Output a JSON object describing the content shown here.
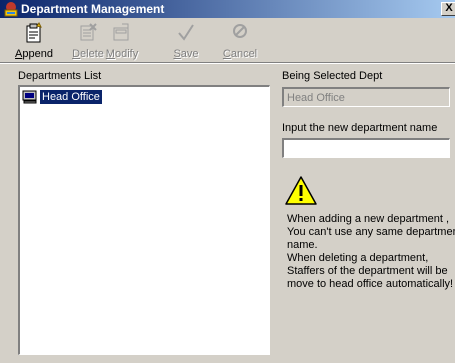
{
  "window": {
    "title": "Department Management",
    "close_label": "X"
  },
  "toolbar": {
    "buttons": [
      {
        "label": "Append",
        "accel": "A",
        "rest": "ppend",
        "enabled": true,
        "icon": "append-icon"
      },
      {
        "label": "Delete",
        "accel": "D",
        "rest": "elete",
        "enabled": false,
        "icon": "delete-icon"
      },
      {
        "label": "Modify",
        "accel": "M",
        "rest": "odify",
        "enabled": false,
        "icon": "modify-icon"
      },
      {
        "label": "Save",
        "accel": "S",
        "rest": "ave",
        "enabled": false,
        "icon": "checkmark-icon"
      },
      {
        "label": "Cancel",
        "accel": "C",
        "rest": "ancel",
        "enabled": false,
        "icon": "cancel-icon"
      }
    ]
  },
  "departments": {
    "label": "Departments List",
    "items": [
      {
        "name": "Head Office",
        "selected": true,
        "icon": "computer-icon"
      }
    ]
  },
  "selected": {
    "label": "Being Selected Dept",
    "value": "Head Office"
  },
  "new_dept": {
    "label": "Input the new department name",
    "value": ""
  },
  "warning": {
    "icon": "warning-icon",
    "lines": [
      "When adding a new department ,",
      "You can't use any same departmen",
      "name.",
      "When deleting a department,",
      "Staffers of the department will be",
      "move to head office automatically!"
    ]
  },
  "colors": {
    "titlebar_start": "#0a246a",
    "titlebar_end": "#a6caf0",
    "face": "#d4d0c8",
    "selection": "#0a246a"
  }
}
